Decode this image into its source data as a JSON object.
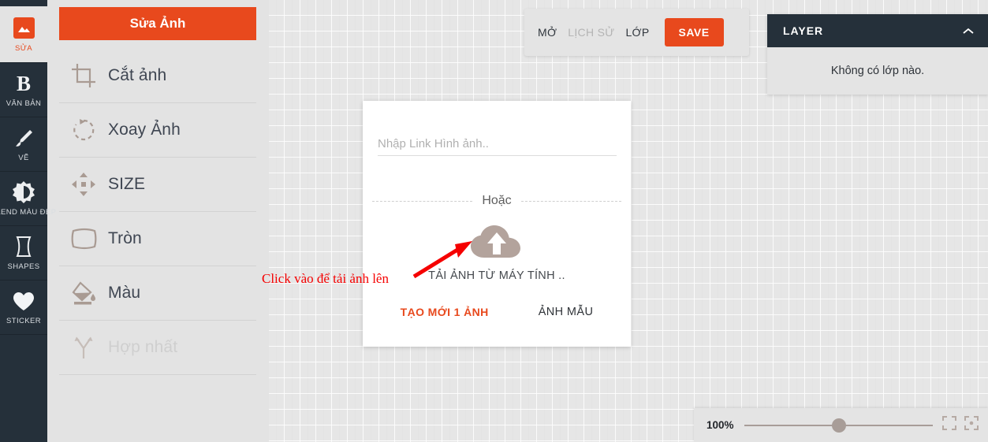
{
  "rail": {
    "items": [
      {
        "label": "SỬA",
        "icon": "image-icon",
        "active": true,
        "disabled": false
      },
      {
        "label": "VĂN BẢN",
        "icon": "text-b-icon",
        "active": false,
        "disabled": false
      },
      {
        "label": "VẼ",
        "icon": "brush-icon",
        "active": false,
        "disabled": false
      },
      {
        "label": "BLEND MÀU ĐẸP",
        "icon": "contrast-icon",
        "active": false,
        "disabled": false
      },
      {
        "label": "SHAPES",
        "icon": "shape-icon",
        "active": false,
        "disabled": false
      },
      {
        "label": "STICKER",
        "icon": "heart-icon",
        "active": false,
        "disabled": false
      }
    ]
  },
  "panel": {
    "header_label": "Sửa Ảnh",
    "tools": [
      {
        "label": "Cắt ảnh",
        "icon": "crop-icon",
        "disabled": false
      },
      {
        "label": "Xoay Ảnh",
        "icon": "rotate-icon",
        "disabled": false
      },
      {
        "label": "SIZE",
        "icon": "move-icon",
        "disabled": false
      },
      {
        "label": "Tròn",
        "icon": "round-icon",
        "disabled": false
      },
      {
        "label": "Màu",
        "icon": "fill-icon",
        "disabled": false
      },
      {
        "label": "Hợp nhất",
        "icon": "merge-icon",
        "disabled": true
      }
    ]
  },
  "toolbar": {
    "open_label": "MỞ",
    "history_label": "LỊCH SỬ",
    "layer_label": "LỚP",
    "save_label": "SAVE"
  },
  "layer_panel": {
    "title": "LAYER",
    "collapse_icon": "chevron-up-icon",
    "empty_message": "Không có lớp nào."
  },
  "dialog": {
    "link_input_placeholder": "Nhập Link Hình ảnh..",
    "link_input_value": "",
    "or_label": "Hoặc",
    "upload_icon": "cloud-upload-icon",
    "upload_label": "TẢI ẢNH TỪ MÁY TÍNH ..",
    "create_new_label": "TẠO MỚI 1 ẢNH",
    "sample_label": "ẢNH MẪU"
  },
  "annotation": {
    "text": "Click vào để tải ảnh lên",
    "arrow_icon": "red-arrow-icon",
    "color": "#f50000"
  },
  "zoombar": {
    "zoom_level": "100%",
    "slider_position_percent": 46.5,
    "fullscreen_icon": "expand-corners-icon",
    "fit_icon": "fit-center-icon"
  },
  "colors": {
    "accent": "#e8491d",
    "dark": "#25303a",
    "panel": "#e3e3e3"
  }
}
